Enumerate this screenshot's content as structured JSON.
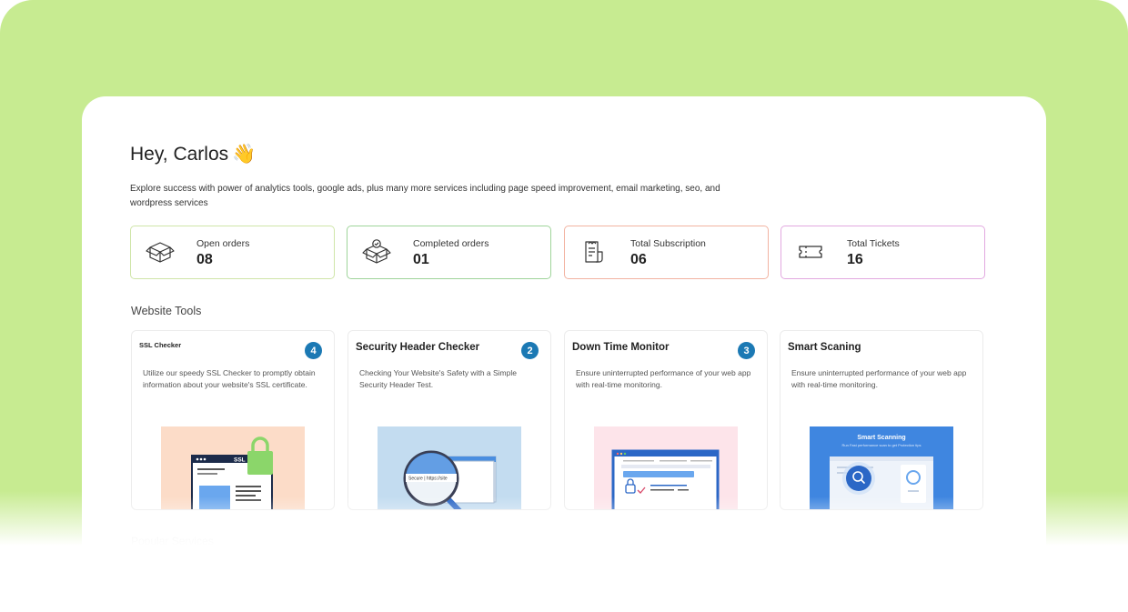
{
  "header": {
    "greeting": "Hey, Carlos",
    "wave": "👋",
    "intro": "Explore success with power of analytics tools, google ads, plus many more services including page speed improvement, email marketing, seo, and wordpress services"
  },
  "stats": [
    {
      "label": "Open orders",
      "value": "08",
      "icon": "box-icon",
      "border": "#cfe5a8"
    },
    {
      "label": "Completed orders",
      "value": "01",
      "icon": "box-check-icon",
      "border": "#9fd49a"
    },
    {
      "label": "Total Subscription",
      "value": "06",
      "icon": "receipt-icon",
      "border": "#f2b3a1"
    },
    {
      "label": "Total Tickets",
      "value": "16",
      "icon": "ticket-icon",
      "border": "#e2a8e0"
    }
  ],
  "website_tools": {
    "title": "Website Tools",
    "tools": [
      {
        "title": "SSL Checker",
        "badge": "4",
        "desc": "Utilize our speedy SSL Checker to promptly obtain information about your website's SSL certificate.",
        "thumb_text": "SSL"
      },
      {
        "title": "Security Header Checker",
        "badge": "2",
        "desc": "Checking Your Website's Safety with a Simple Security Header Test.",
        "thumb_text": "Secure | https://site"
      },
      {
        "title": "Down Time Monitor",
        "badge": "3",
        "desc": "Ensure uninterrupted performance of your web app with real-time monitoring."
      },
      {
        "title": "Smart Scaning",
        "desc": "Ensure uninterrupted performance of your web app with real-time monitoring.",
        "thumb_title": "Smart Scanning",
        "thumb_sub": "Run Fast performance scan to get Protection tips"
      }
    ]
  },
  "next_section": {
    "title": "Popular Services"
  }
}
